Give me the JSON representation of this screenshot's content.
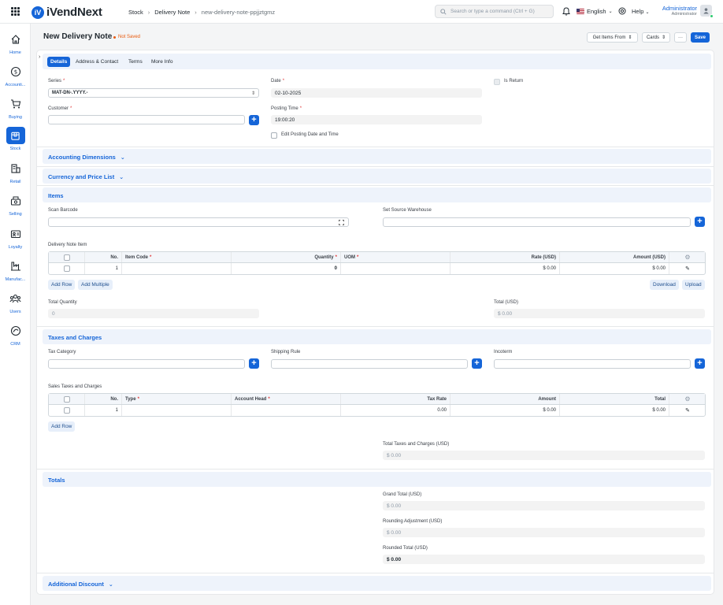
{
  "navbar": {
    "logo": "iVendNext",
    "breadcrumb": [
      "Stock",
      "Delivery Note",
      "new-delivery-note-ppjjztgmz"
    ],
    "search_placeholder": "Search or type a command (Ctrl + G)",
    "language": "English",
    "help": "Help",
    "user_name": "Administrator",
    "user_role": "Administrator"
  },
  "sidebar": [
    {
      "label": "Home",
      "icon": "home-icon"
    },
    {
      "label": "Accounti...",
      "icon": "dollar-icon"
    },
    {
      "label": "Buying",
      "icon": "cart-icon"
    },
    {
      "label": "Stock",
      "icon": "box-icon",
      "active": true
    },
    {
      "label": "Retail",
      "icon": "store-icon"
    },
    {
      "label": "Selling",
      "icon": "register-icon"
    },
    {
      "label": "Loyalty",
      "icon": "loyalty-card-icon"
    },
    {
      "label": "Manufac...",
      "icon": "factory-icon"
    },
    {
      "label": "Users",
      "icon": "users-icon"
    },
    {
      "label": "CRM",
      "icon": "crm-icon"
    }
  ],
  "page": {
    "title": "New Delivery Note",
    "status": "Not Saved",
    "get_items": "Get Items From",
    "cards": "Cards",
    "more": "···",
    "save": "Save"
  },
  "tabs": [
    "Details",
    "Address & Contact",
    "Terms",
    "More Info"
  ],
  "details": {
    "series_label": "Series",
    "series_value": "MAT-DN-.YYYY.-",
    "customer_label": "Customer",
    "date_label": "Date",
    "date_value": "02-10-2025",
    "posting_time_label": "Posting Time",
    "posting_time_value": "19:00:20",
    "edit_posting_label": "Edit Posting Date and Time",
    "is_return_label": "Is Return"
  },
  "sections": {
    "accounting_dimensions": "Accounting Dimensions",
    "currency_price_list": "Currency and Price List",
    "items": "Items",
    "taxes": "Taxes and Charges",
    "totals": "Totals",
    "additional_discount": "Additional Discount"
  },
  "items": {
    "scan_barcode_label": "Scan Barcode",
    "source_warehouse_label": "Set Source Warehouse",
    "grid_label": "Delivery Note Item",
    "columns": {
      "no": "No.",
      "item_code": "Item Code",
      "quantity": "Quantity",
      "uom": "UOM",
      "rate": "Rate (USD)",
      "amount": "Amount (USD)"
    },
    "row": {
      "no": "1",
      "quantity": "0",
      "rate": "$ 0.00",
      "amount": "$ 0.00"
    },
    "add_row": "Add Row",
    "add_multiple": "Add Multiple",
    "download": "Download",
    "upload": "Upload",
    "total_qty_label": "Total Quantity",
    "total_qty_value": "0",
    "total_label": "Total (USD)",
    "total_value": "$ 0.00"
  },
  "taxes": {
    "tax_category_label": "Tax Category",
    "shipping_rule_label": "Shipping Rule",
    "incoterm_label": "Incoterm",
    "grid_label": "Sales Taxes and Charges",
    "columns": {
      "no": "No.",
      "type": "Type",
      "account_head": "Account Head",
      "tax_rate": "Tax Rate",
      "amount": "Amount",
      "total": "Total"
    },
    "row": {
      "no": "1",
      "tax_rate": "0.00",
      "amount": "$ 0.00",
      "total": "$ 0.00"
    },
    "add_row": "Add Row",
    "total_taxes_label": "Total Taxes and Charges (USD)",
    "total_taxes_value": "$ 0.00"
  },
  "totals": {
    "grand_total_label": "Grand Total (USD)",
    "grand_total_value": "$ 0.00",
    "rounding_label": "Rounding Adjustment (USD)",
    "rounding_value": "$ 0.00",
    "rounded_total_label": "Rounded Total (USD)",
    "rounded_total_value": "$ 0.00"
  },
  "colors": {
    "primary": "#1565d8",
    "not_saved": "#e8590c"
  }
}
